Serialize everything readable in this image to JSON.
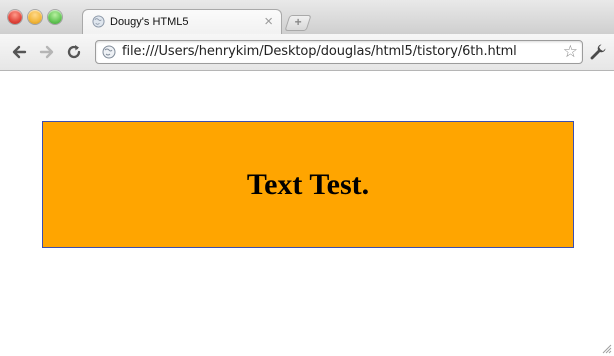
{
  "window": {
    "tab_title": "Dougy's HTML5",
    "tab_close_glyph": "×",
    "new_tab_glyph": "+"
  },
  "toolbar": {
    "url": "file:///Users/henrykim/Desktop/douglas/html5/tistory/6th.html",
    "star_glyph": "☆"
  },
  "page": {
    "heading": "Text Test.",
    "box_color": "#ffa500",
    "box_border_color": "#3b4fb0"
  },
  "icons": {
    "favicon": "globe-icon",
    "back": "back-arrow-icon",
    "forward": "forward-arrow-icon",
    "reload": "reload-icon",
    "page_icon": "globe-icon",
    "bookmark": "star-icon",
    "settings": "wrench-icon"
  }
}
